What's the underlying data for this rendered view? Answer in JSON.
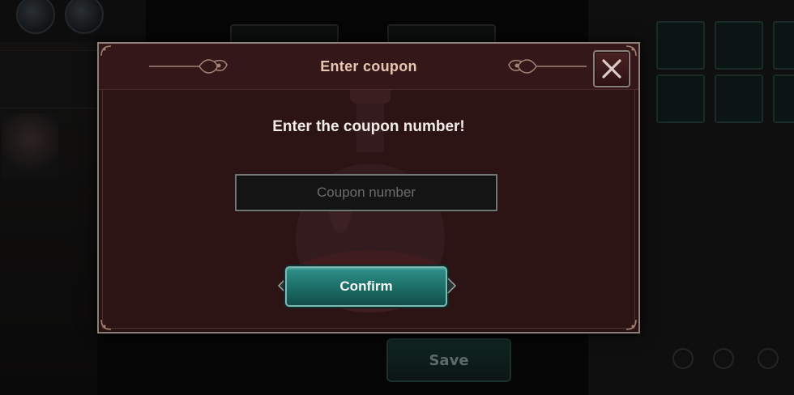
{
  "dialog": {
    "title": "Enter coupon",
    "message": "Enter the coupon number!",
    "input_placeholder": "Coupon number",
    "input_value": "",
    "confirm_label": "Confirm",
    "close_icon": "close-x-icon"
  },
  "background": {
    "save_label": "Save"
  },
  "colors": {
    "dialog_bg": "#2c1314",
    "dialog_border": "#8e7f7b",
    "title_text": "#e7c7b3",
    "confirm_button": "#1c6c66"
  }
}
